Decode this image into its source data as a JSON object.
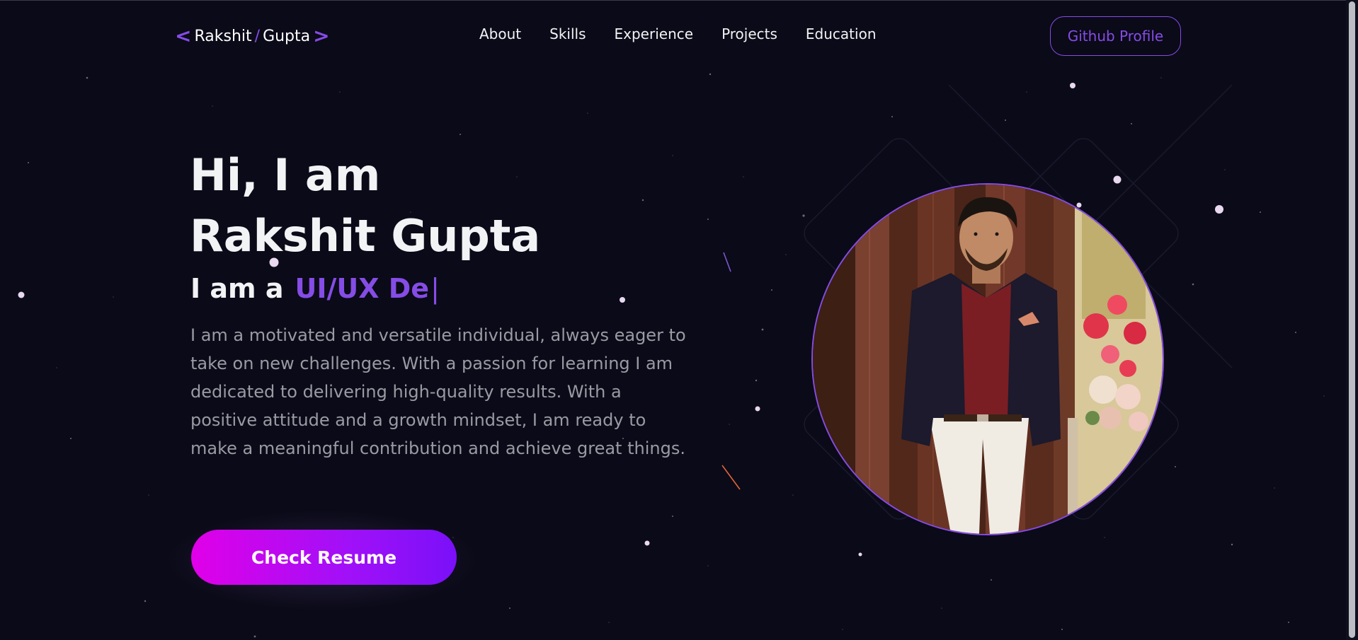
{
  "nav": {
    "logo": {
      "first": "Rakshit",
      "separator": "/",
      "last": "Gupta",
      "left_chevron": "<",
      "right_chevron": ">"
    },
    "links": [
      "About",
      "Skills",
      "Experience",
      "Projects",
      "Education"
    ],
    "github_button": "Github Profile"
  },
  "hero": {
    "greeting_line1": "Hi, I am",
    "greeting_line2": "Rakshit Gupta",
    "typing_prefix": "I am a",
    "typing_role": "UI/UX De",
    "typing_cursor": "|",
    "description": "I am a motivated and versatile individual, always eager to take on new challenges. With a passion for learning I am dedicated to delivering high-quality results. With a positive attitude and a growth mindset, I am ready to make a meaningful contribution and achieve great things.",
    "resume_button": "Check Resume"
  },
  "profile_image": {
    "icon": "profile-photo"
  },
  "colors": {
    "background": "#0b0a18",
    "accent": "#854ce6",
    "text_primary": "#f2f3f4",
    "text_secondary": "#9a9aa3",
    "button_gradient_start": "#e000e8",
    "button_gradient_end": "#7a10f8"
  }
}
